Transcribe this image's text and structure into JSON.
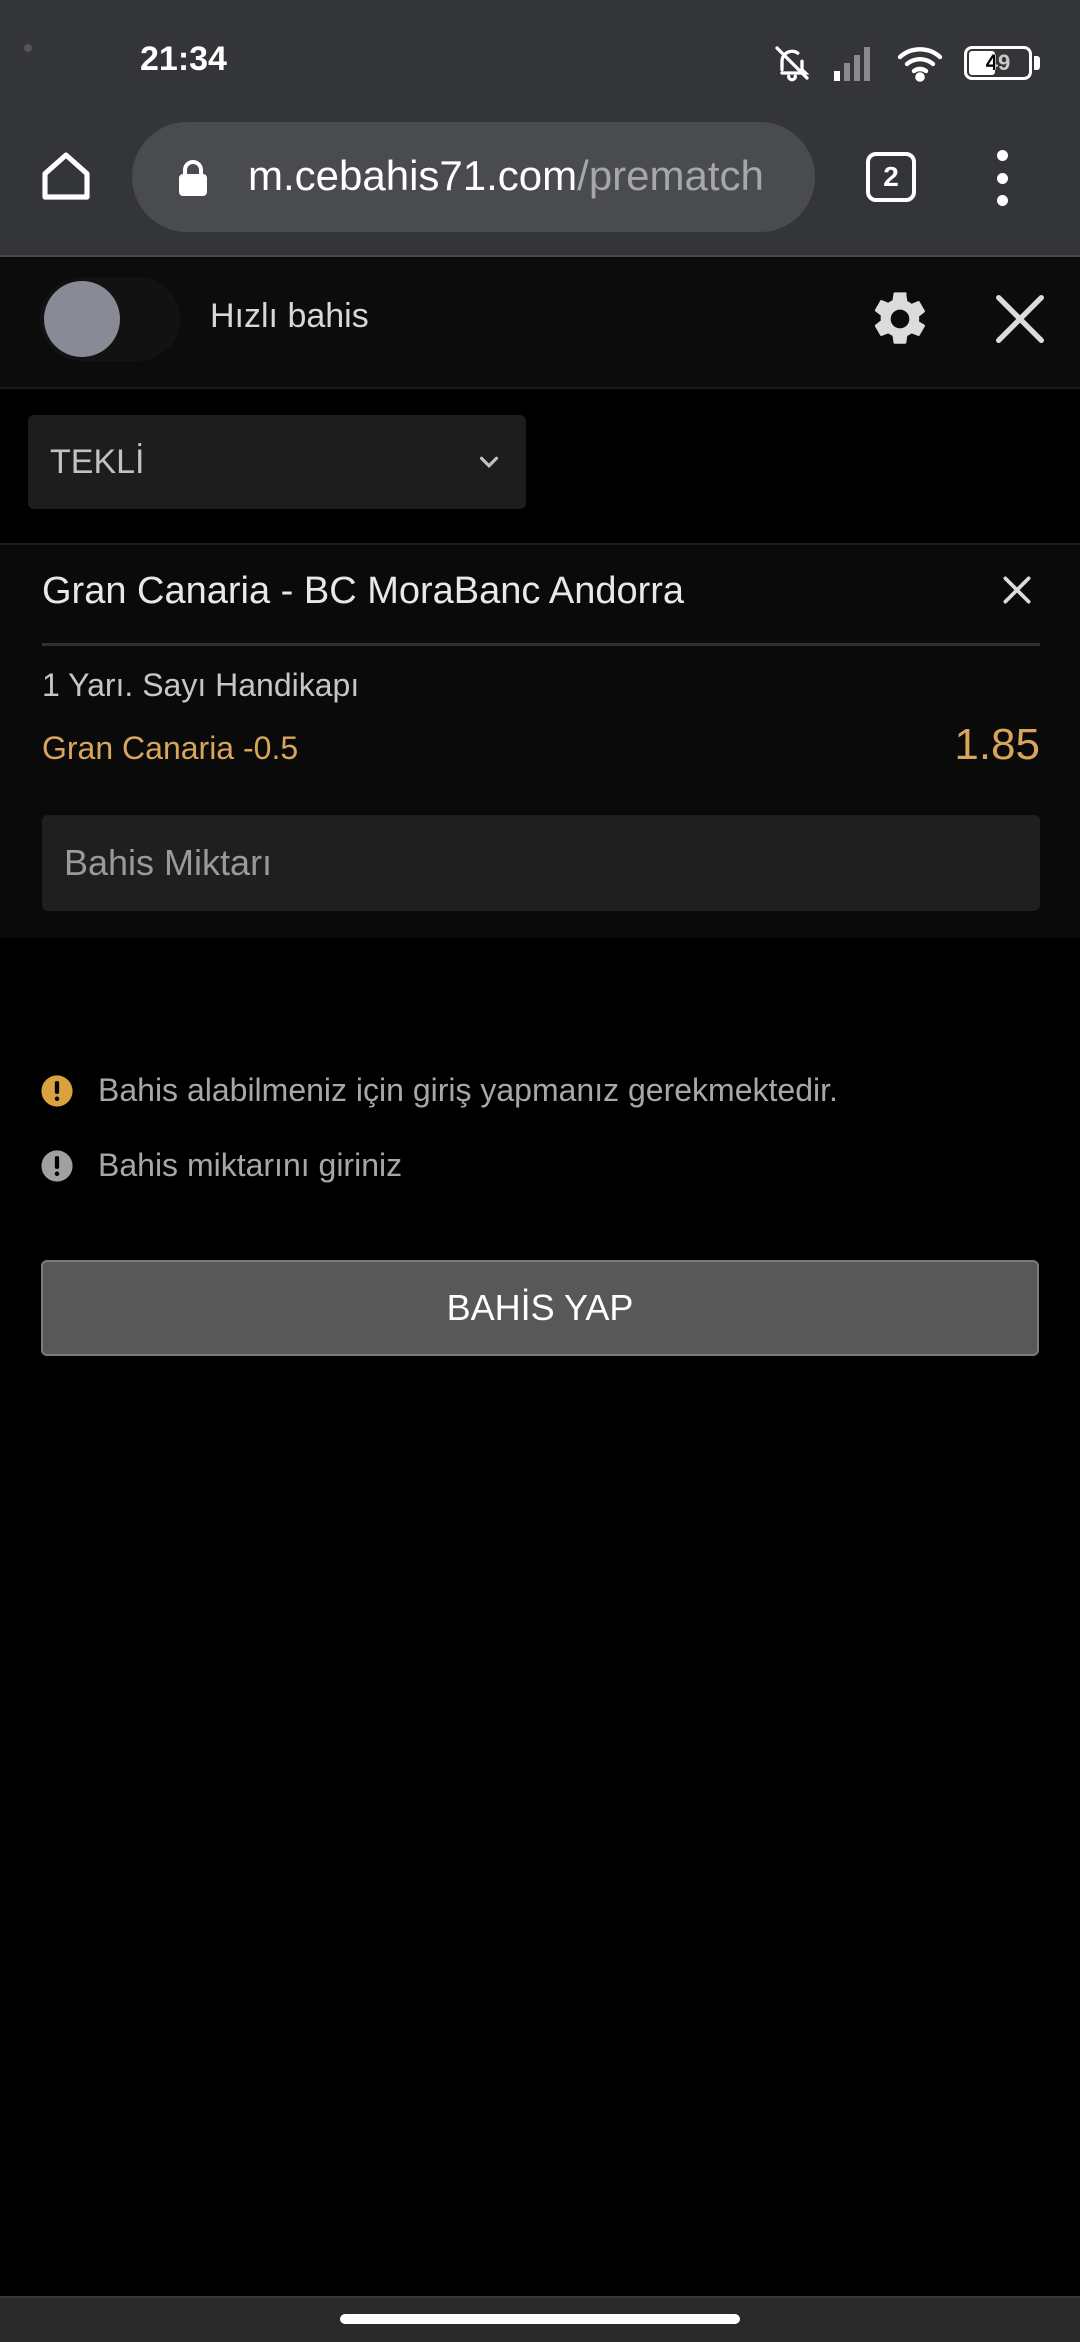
{
  "status_bar": {
    "time": "21:34",
    "battery_level": "49",
    "icons": [
      "bell-off-icon",
      "cellular-signal-icon",
      "wifi-icon",
      "battery-icon"
    ]
  },
  "browser": {
    "url_domain": "m.cebahis71.com",
    "url_path": "/prematch",
    "tab_count": "2"
  },
  "betslip": {
    "quick_bet_label": "Hızlı bahis",
    "bet_type": "TEKLİ",
    "match": "Gran Canaria - BC MoraBanc Andorra",
    "market": "1 Yarı. Sayı Handikapı",
    "selection": "Gran Canaria -0.5",
    "odds": "1.85",
    "stake_placeholder": "Bahis Miktarı",
    "messages": [
      {
        "text": "Bahis alabilmeniz için giriş yapmanız gerekmektedir.",
        "color": "#d9a23f"
      },
      {
        "text": "Bahis miktarını giriniz",
        "color": "#a0a0a0"
      }
    ],
    "place_bet_label": "BAHİS YAP"
  },
  "colors": {
    "accent": "#d9a45c",
    "background": "#000000",
    "chrome": "#343538"
  }
}
